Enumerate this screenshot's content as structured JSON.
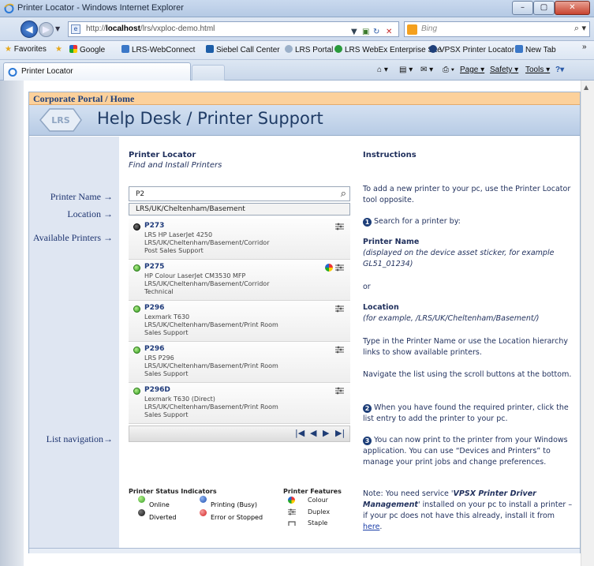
{
  "window": {
    "title": "Printer Locator - Windows Internet Explorer",
    "controls": {
      "minimize": "–",
      "maximize": "▢",
      "close": "✕"
    }
  },
  "address": {
    "url_prefix": "http://",
    "url_host": "localhost",
    "url_path": "/lrs/vxploc-demo.html",
    "search_placeholder": "Bing"
  },
  "favorites": {
    "label": "Favorites",
    "items": [
      {
        "label": "Google",
        "icon": "google-icon"
      },
      {
        "label": "LRS-WebConnect",
        "icon": "ie-page-icon"
      },
      {
        "label": "Siebel Call Center",
        "icon": "siebel-icon"
      },
      {
        "label": "LRS Portal",
        "icon": "lrs-icon"
      },
      {
        "label": "LRS WebEx Enterprise Site",
        "icon": "webex-icon"
      },
      {
        "label": "VPSX Printer Locator",
        "icon": "vpsx-icon"
      },
      {
        "label": "New Tab",
        "icon": "ie-page-icon"
      }
    ],
    "overflow": "»"
  },
  "tabs": {
    "active": "Printer Locator",
    "commands": [
      "Page",
      "Safety",
      "Tools"
    ]
  },
  "portal": {
    "breadcrumb": "Corporate Portal / Home",
    "logo_text": "LRS",
    "title": "Help Desk / Printer Support"
  },
  "labels": {
    "printer_name": "Printer Name →",
    "location": "Location →",
    "available": "Available Printers →",
    "list_nav": "List navigation→"
  },
  "locator": {
    "heading": "Printer Locator",
    "subheading": "Find and Install Printers",
    "printer_name_value": "P2",
    "location_value": "LRS/UK/Cheltenham/Basement",
    "printers": [
      {
        "name": "P273",
        "model": "LRS HP LaserJet 4250",
        "path": "LRS/UK/Cheltenham/Basement/Corridor",
        "dept": "Post Sales Support",
        "status": "diverted",
        "colour": false
      },
      {
        "name": "P275",
        "model": "HP Colour LaserJet CM3530 MFP",
        "path": "LRS/UK/Cheltenham/Basement/Corridor",
        "dept": "Technical",
        "status": "online",
        "colour": true
      },
      {
        "name": "P296",
        "model": "Lexmark T630",
        "path": "LRS/UK/Cheltenham/Basement/Print Room",
        "dept": "Sales Support",
        "status": "online",
        "colour": false
      },
      {
        "name": "P296",
        "model": "LRS P296",
        "path": "LRS/UK/Cheltenham/Basement/Print Room",
        "dept": "Sales Support",
        "status": "online",
        "colour": false
      },
      {
        "name": "P296D",
        "model": "Lexmark T630 (Direct)",
        "path": "LRS/UK/Cheltenham/Basement/Print Room",
        "dept": "Sales Support",
        "status": "online",
        "colour": false
      }
    ],
    "nav": [
      "|◀",
      "◀",
      "▶",
      "▶|"
    ]
  },
  "legend": {
    "status_title": "Printer Status Indicators",
    "features_title": "Printer Features",
    "online": "Online",
    "printing": "Printing (Busy)",
    "diverted": "Diverted",
    "error": "Error or Stopped",
    "colour": "Colour",
    "duplex": "Duplex",
    "staple": "Staple",
    "colors": {
      "online": "#3aa82a",
      "printing": "#2b62c9",
      "diverted": "#222222",
      "error": "#e03030"
    }
  },
  "instructions": {
    "heading": "Instructions",
    "p1": "To add a new printer to your pc, use the Printer Locator tool opposite.",
    "step1": "Search for a printer by:",
    "pn_title": "Printer Name",
    "pn_desc": "(displayed on the device asset sticker, for example GL51_01234)",
    "or": "or",
    "loc_title": "Location",
    "loc_desc": "(for example, /LRS/UK/Cheltenham/Basement/)",
    "p_type": "Type in the Printer Name or use the Location hierarchy links to show available printers.",
    "p_nav": "Navigate the list using the scroll buttons at the bottom.",
    "step2": "When you have found the required printer, click the list entry to add the printer to your pc.",
    "step3": "You can now print to the printer from your Windows application.  You can use “Devices and Printers” to manage your print jobs and change preferences.",
    "note_a": "Note: You need service '",
    "note_b": "VPSX Printer Driver Management",
    "note_c": "' installed on your pc to install a printer – if your pc does not have this already, install it from ",
    "note_link": "here",
    "note_d": "."
  }
}
